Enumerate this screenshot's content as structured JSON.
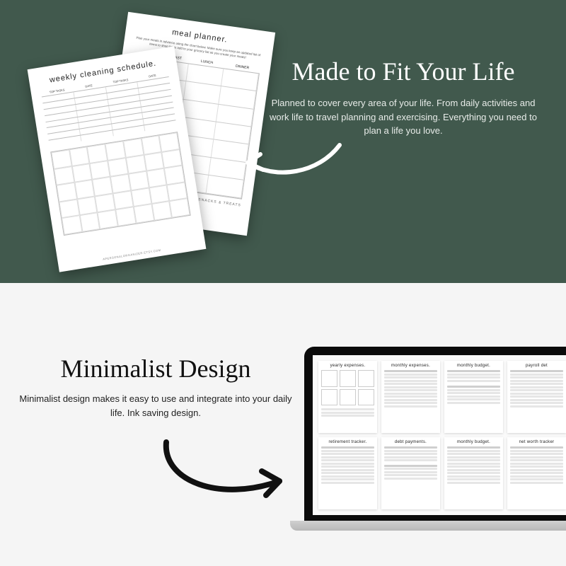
{
  "top": {
    "heading": "Made to Fit Your Life",
    "body": "Planned to cover every area of your life. From daily activities and work life to travel planning and exercising. Everything you need to plan a life you love."
  },
  "bottom": {
    "heading": "Minimalist Design",
    "body": "Minimalist design makes it easy to use and integrate into your daily life. Ink saving design."
  },
  "pages": {
    "front": {
      "title": "weekly cleaning schedule.",
      "cols": [
        "TOP TASKS",
        "DATE",
        "TOP TASKS",
        "DATE"
      ],
      "footer": "APERSONALORGANIZER.ETSY.COM"
    },
    "back": {
      "title": "meal planner.",
      "sub": "Plan your meals in advance using the chart below. Make sure you keep an updated list of items to shop for to add to your grocery list as you create your meals!",
      "cols": [
        "",
        "BREAKFAST",
        "LUNCH",
        "DINNER"
      ],
      "snacks": "SNACKS & TREATS"
    }
  },
  "thumbs": [
    "yearly expenses.",
    "monthly expenses.",
    "monthly budget.",
    "payroll det",
    "retirement tracker.",
    "debt payments.",
    "monthly budget.",
    "net worth tracker"
  ]
}
